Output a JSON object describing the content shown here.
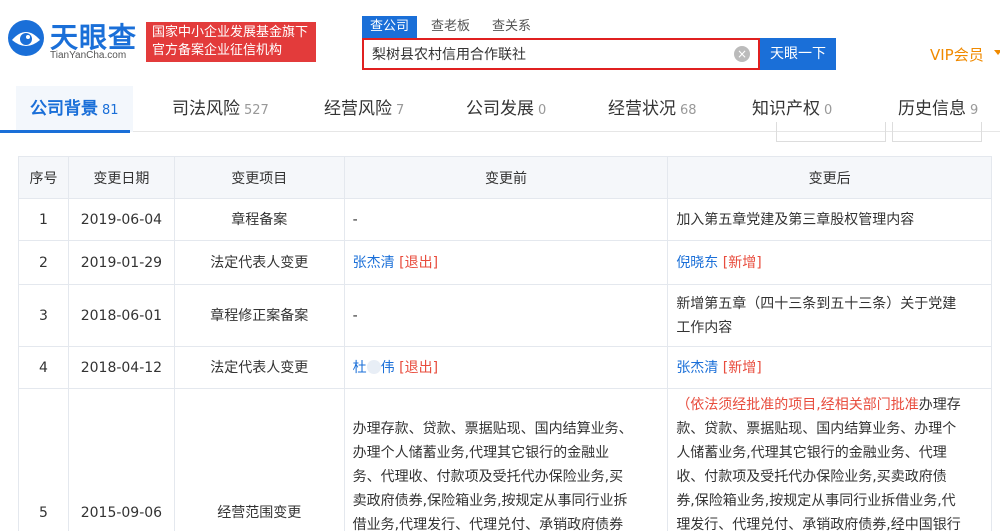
{
  "header": {
    "logo_cn": "天眼查",
    "logo_en": "TianYanCha.com",
    "badge_line1": "国家中小企业发展基金旗下",
    "badge_line2": "官方备案企业征信机构",
    "search_tabs": [
      "查公司",
      "查老板",
      "查关系"
    ],
    "search_value": "梨树县农村信用合作联社",
    "search_clear": "×",
    "search_button": "天眼一下",
    "vip": "VIP会员"
  },
  "nav": [
    {
      "label": "公司背景",
      "count": "81"
    },
    {
      "label": "司法风险",
      "count": "527"
    },
    {
      "label": "经营风险",
      "count": "7"
    },
    {
      "label": "公司发展",
      "count": "0"
    },
    {
      "label": "经营状况",
      "count": "68"
    },
    {
      "label": "知识产权",
      "count": "0"
    },
    {
      "label": "历史信息",
      "count": "9"
    }
  ],
  "table": {
    "headers": [
      "序号",
      "变更日期",
      "变更项目",
      "变更前",
      "变更后"
    ],
    "rows": [
      {
        "no": "1",
        "date": "2019-06-04",
        "item": "章程备案",
        "before": "-",
        "after": "加入第五章党建及第三章股权管理内容"
      },
      {
        "no": "2",
        "date": "2019-01-29",
        "item": "法定代表人变更",
        "before_name": "张杰清",
        "before_tag": "[退出]",
        "after_name": "倪晓东",
        "after_tag": "[新增]"
      },
      {
        "no": "3",
        "date": "2018-06-01",
        "item": "章程修正案备案",
        "before": "-",
        "after_l1": "新增第五章（四十三条到五十三条）关于党建",
        "after_l2": "工作内容"
      },
      {
        "no": "4",
        "date": "2018-04-12",
        "item": "法定代表人变更",
        "before_name_a": "杜",
        "before_name_b": "伟",
        "before_tag": "[退出]",
        "after_name": "张杰清",
        "after_tag": "[新增]"
      },
      {
        "no": "5",
        "date": "2015-09-06",
        "item": "经营范围变更",
        "before_lines": [
          "办理存款、贷款、票据贴现、国内结算业务、",
          "办理个人储蓄业务,代理其它银行的金融业",
          "务、代理收、付款项及受托代办保险业务,买",
          "卖政府债券,保险箱业务,按规定从事同行业拆",
          "借业务,代理发行、代理兑付、承销政府债券"
        ],
        "after_red": "（依法须经批准的项目,经相关部门批准",
        "after_first_rest": "办理存",
        "after_lines": [
          "款、贷款、票据贴现、国内结算业务、办理个",
          "人储蓄业务,代理其它银行的金融业务、代理",
          "收、付款项及受托代办保险业务,买卖政府债",
          "券,保险箱业务,按规定从事同行业拆借业务,代",
          "理发行、代理兑付、承销政府债券,经中国银行"
        ]
      }
    ]
  }
}
